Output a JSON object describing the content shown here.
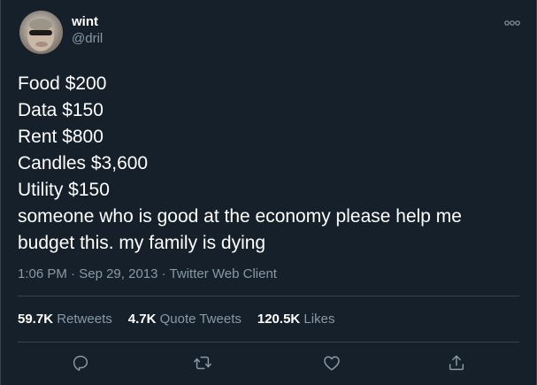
{
  "user": {
    "display_name": "wint",
    "handle": "@dril"
  },
  "tweet": {
    "lines": [
      "Food $200",
      "Data $150",
      "Rent $800",
      "Candles $3,600",
      "Utility $150",
      "someone who is good at the economy please help me",
      "budget this. my family is dying"
    ],
    "time": "1:06 PM",
    "date": "Sep 29, 2013",
    "client": "Twitter Web Client",
    "separator": "·"
  },
  "stats": {
    "retweets_count": "59.7K",
    "retweets_label": "Retweets",
    "quotes_count": "4.7K",
    "quotes_label": "Quote Tweets",
    "likes_count": "120.5K",
    "likes_label": "Likes"
  },
  "icons": {
    "more": "more-icon",
    "reply": "reply-icon",
    "retweet": "retweet-icon",
    "like": "like-icon",
    "share": "share-icon"
  },
  "colors": {
    "background": "#15202b",
    "text": "#ffffff",
    "secondary": "#8899a6",
    "border": "#38444d"
  }
}
